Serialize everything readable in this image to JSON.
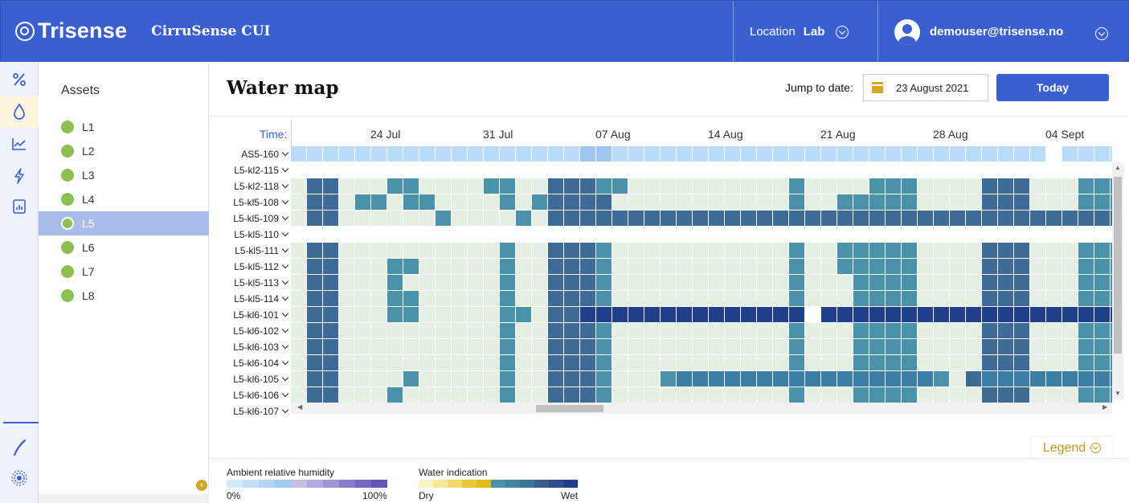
{
  "header": {
    "brand": "Trisense",
    "app_name": "CirruSense CUI",
    "location_label": "Location",
    "location_value": "Lab",
    "user_email": "demouser@trisense.no"
  },
  "rail": {
    "items": [
      {
        "name": "percent-icon",
        "glyph": "%"
      },
      {
        "name": "water-drop-icon",
        "glyph": "💧"
      },
      {
        "name": "line-chart-icon",
        "glyph": "📈"
      },
      {
        "name": "power-icon",
        "glyph": "ϟ"
      },
      {
        "name": "report-icon",
        "glyph": "▤"
      }
    ],
    "bottom_items": [
      {
        "name": "curve-icon",
        "glyph": "∕"
      },
      {
        "name": "signal-icon",
        "glyph": "◉"
      }
    ]
  },
  "assets": {
    "title": "Assets",
    "items": [
      "L1",
      "L2",
      "L3",
      "L4",
      "L5",
      "L6",
      "L7",
      "L8"
    ],
    "active": "L5"
  },
  "main": {
    "title": "Water map",
    "jump_label": "Jump to date:",
    "date_value": "23 August 2021",
    "today_button": "Today"
  },
  "water_map": {
    "time_label": "Time:",
    "date_ticks": [
      "24 Jul",
      "31 Jul",
      "07 Aug",
      "14 Aug",
      "21 Aug",
      "28 Aug",
      "04 Sept"
    ],
    "rows": [
      "AS5-160",
      "L5-kl2-115",
      "L5-kl2-118",
      "L5-kl5-108",
      "L5-kl5-109",
      "L5-kl5-110",
      "L5-kl5-111",
      "L5-kl5-112",
      "L5-kl5-113",
      "L5-kl5-114",
      "L5-kl6-101",
      "L5-kl6-102",
      "L5-kl6-103",
      "L5-kl6-104",
      "L5-kl6-105",
      "L5-kl6-106",
      "L5-kl6-107"
    ],
    "palette": {
      "0": "#ffffff",
      "1": "#e6efe4",
      "2": "#4a92aa",
      "3": "#3d6b96",
      "4": "#203f8a",
      "5": "#bbdcf6",
      "6": "#9fc6ef",
      "7": "#3a7ea6",
      "8": "#3a86a0"
    }
  },
  "legend": {
    "toggle_label": "Legend",
    "humidity": {
      "title": "Ambient relative humidity",
      "min": "0%",
      "max": "100%",
      "colors": [
        "#d6e8fb",
        "#c4dff7",
        "#b2d5f4",
        "#a2cdf1",
        "#c2c0e4",
        "#b1aadf",
        "#9e94d6",
        "#8a7dcc",
        "#7669c3",
        "#5f55b8"
      ]
    },
    "water": {
      "title": "Water indication",
      "min": "Dry",
      "max": "Wet",
      "colors": [
        "#fcf3c4",
        "#f7e79a",
        "#f1d96b",
        "#eac83d",
        "#e4b91a",
        "#4a92aa",
        "#4285a0",
        "#3b7698",
        "#37608f",
        "#2f4d8c",
        "#203f8a"
      ]
    }
  }
}
